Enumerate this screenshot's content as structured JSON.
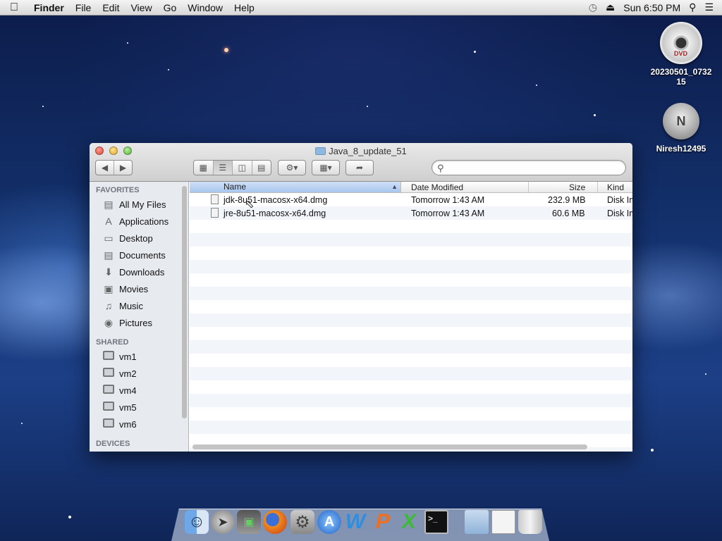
{
  "menubar": {
    "app_name": "Finder",
    "menus": [
      "File",
      "Edit",
      "View",
      "Go",
      "Window",
      "Help"
    ],
    "clock": "Sun 6:50 PM"
  },
  "desktop": {
    "icons": [
      {
        "label": "20230501_073215",
        "kind": "dvd-disc"
      },
      {
        "label": "Niresh12495",
        "kind": "disk"
      }
    ]
  },
  "window": {
    "title": "Java_8_update_51",
    "sidebar": {
      "favorites_header": "FAVORITES",
      "favorites": [
        {
          "label": "All My Files",
          "icon": "all-files-icon"
        },
        {
          "label": "Applications",
          "icon": "applications-icon"
        },
        {
          "label": "Desktop",
          "icon": "desktop-icon"
        },
        {
          "label": "Documents",
          "icon": "documents-icon"
        },
        {
          "label": "Downloads",
          "icon": "downloads-icon"
        },
        {
          "label": "Movies",
          "icon": "movies-icon"
        },
        {
          "label": "Music",
          "icon": "music-icon"
        },
        {
          "label": "Pictures",
          "icon": "pictures-icon"
        }
      ],
      "shared_header": "SHARED",
      "shared": [
        {
          "label": "vm1"
        },
        {
          "label": "vm2"
        },
        {
          "label": "vm4"
        },
        {
          "label": "vm5"
        },
        {
          "label": "vm6"
        }
      ],
      "devices_header": "DEVICES"
    },
    "columns": {
      "name": "Name",
      "date": "Date Modified",
      "size": "Size",
      "kind": "Kind"
    },
    "files": [
      {
        "name": "jdk-8u51-macosx-x64.dmg",
        "date": "Tomorrow 1:43 AM",
        "size": "232.9 MB",
        "kind": "Disk Im"
      },
      {
        "name": "jre-8u51-macosx-x64.dmg",
        "date": "Tomorrow 1:43 AM",
        "size": "60.6 MB",
        "kind": "Disk Im"
      }
    ]
  },
  "dock": {
    "items": [
      "finder",
      "launchpad",
      "system-info",
      "firefox",
      "system-preferences",
      "app-store",
      "word",
      "powerpoint",
      "excel",
      "terminal",
      "applications-folder",
      "preview",
      "trash"
    ]
  }
}
